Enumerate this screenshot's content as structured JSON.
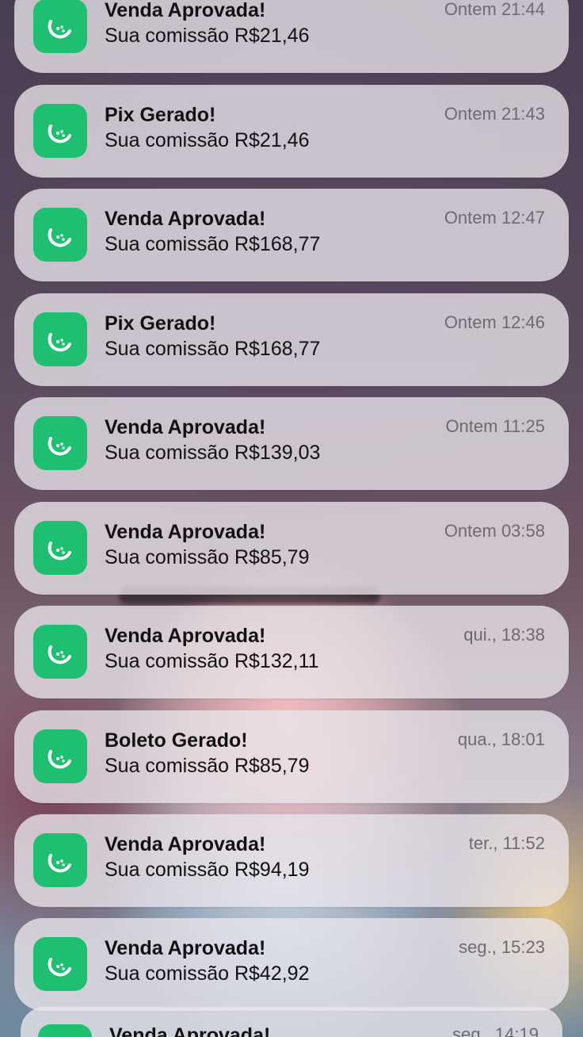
{
  "notifications": [
    {
      "title": "Venda Aprovada!",
      "body": "Sua comissão R$21,46",
      "time": "Ontem 21:44"
    },
    {
      "title": "Pix Gerado!",
      "body": "Sua comissão R$21,46",
      "time": "Ontem 21:43"
    },
    {
      "title": "Venda Aprovada!",
      "body": "Sua comissão R$168,77",
      "time": "Ontem 12:47"
    },
    {
      "title": "Pix Gerado!",
      "body": "Sua comissão R$168,77",
      "time": "Ontem 12:46"
    },
    {
      "title": "Venda Aprovada!",
      "body": "Sua comissão R$139,03",
      "time": "Ontem 11:25"
    },
    {
      "title": "Venda Aprovada!",
      "body": "Sua comissão R$85,79",
      "time": "Ontem 03:58"
    },
    {
      "title": "Venda Aprovada!",
      "body": "Sua comissão R$132,11",
      "time": "qui., 18:38"
    },
    {
      "title": "Boleto Gerado!",
      "body": "Sua comissão R$85,79",
      "time": "qua., 18:01"
    },
    {
      "title": "Venda Aprovada!",
      "body": "Sua comissão R$94,19",
      "time": "ter., 11:52"
    },
    {
      "title": "Venda Aprovada!",
      "body": "Sua comissão R$42,92",
      "time": "seg., 15:23"
    },
    {
      "title": "Venda Aprovada!",
      "body": "",
      "time": "seg., 14:19"
    }
  ],
  "app_icon": {
    "name": "lime-slice-icon",
    "color": "#1fbf72"
  }
}
